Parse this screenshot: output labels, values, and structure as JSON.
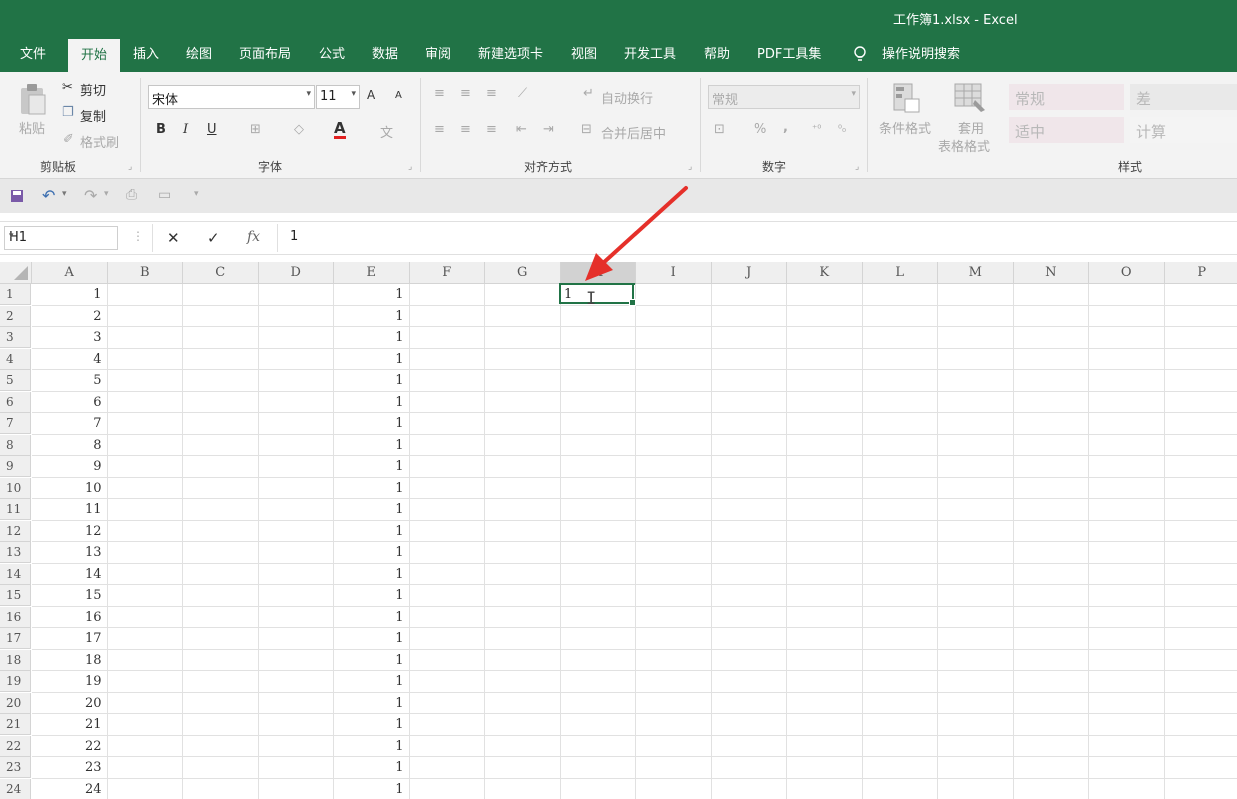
{
  "window": {
    "title": "工作簿1.xlsx  -  Excel"
  },
  "tabs": [
    "文件",
    "开始",
    "插入",
    "绘图",
    "页面布局",
    "公式",
    "数据",
    "审阅",
    "新建选项卡",
    "视图",
    "开发工具",
    "帮助",
    "PDF工具集"
  ],
  "tell_me": "操作说明搜索",
  "ribbon": {
    "clipboard": {
      "paste": "粘贴",
      "cut": "剪切",
      "copy": "复制",
      "format_painter": "格式刷",
      "label": "剪贴板"
    },
    "font": {
      "name": "宋体",
      "size": "11",
      "grow": "A",
      "shrink": "A",
      "bold": "B",
      "italic": "I",
      "underline": "U",
      "font_color": "A",
      "phonetic": "文",
      "label": "字体"
    },
    "alignment": {
      "wrap": "自动换行",
      "merge": "合并后居中",
      "label": "对齐方式"
    },
    "number": {
      "format": "常规",
      "percent": "%",
      "comma": ",",
      "label": "数字"
    },
    "styles": {
      "conditional": "条件格式",
      "table_1": "套用",
      "table_2": "表格格式",
      "normal": "常规",
      "bad": "差",
      "neutral": "适中",
      "calc": "计算",
      "label": "样式"
    }
  },
  "formula_bar": {
    "name_box": "H1",
    "fx": "fx",
    "content": "1"
  },
  "columns": [
    "A",
    "B",
    "C",
    "D",
    "E",
    "F",
    "G",
    "H",
    "I",
    "J",
    "K",
    "L",
    "M",
    "N",
    "O",
    "P"
  ],
  "selected_column": "H",
  "rows": [
    "1",
    "2",
    "3",
    "4",
    "5",
    "6",
    "7",
    "8",
    "9",
    "10",
    "11",
    "12",
    "13",
    "14",
    "15",
    "16",
    "17",
    "18",
    "19",
    "20",
    "21",
    "22",
    "23",
    "24"
  ],
  "col_a": [
    "1",
    "2",
    "3",
    "4",
    "5",
    "6",
    "7",
    "8",
    "9",
    "10",
    "11",
    "12",
    "13",
    "14",
    "15",
    "16",
    "17",
    "18",
    "19",
    "20",
    "21",
    "22",
    "23",
    "24"
  ],
  "col_e": [
    "1",
    "1",
    "1",
    "1",
    "1",
    "1",
    "1",
    "1",
    "1",
    "1",
    "1",
    "1",
    "1",
    "1",
    "1",
    "1",
    "1",
    "1",
    "1",
    "1",
    "1",
    "1",
    "1",
    "1"
  ],
  "active_cell": {
    "ref": "H1",
    "text": "1"
  },
  "colors": {
    "brand": "#217346",
    "annotation": "#e5302a"
  }
}
